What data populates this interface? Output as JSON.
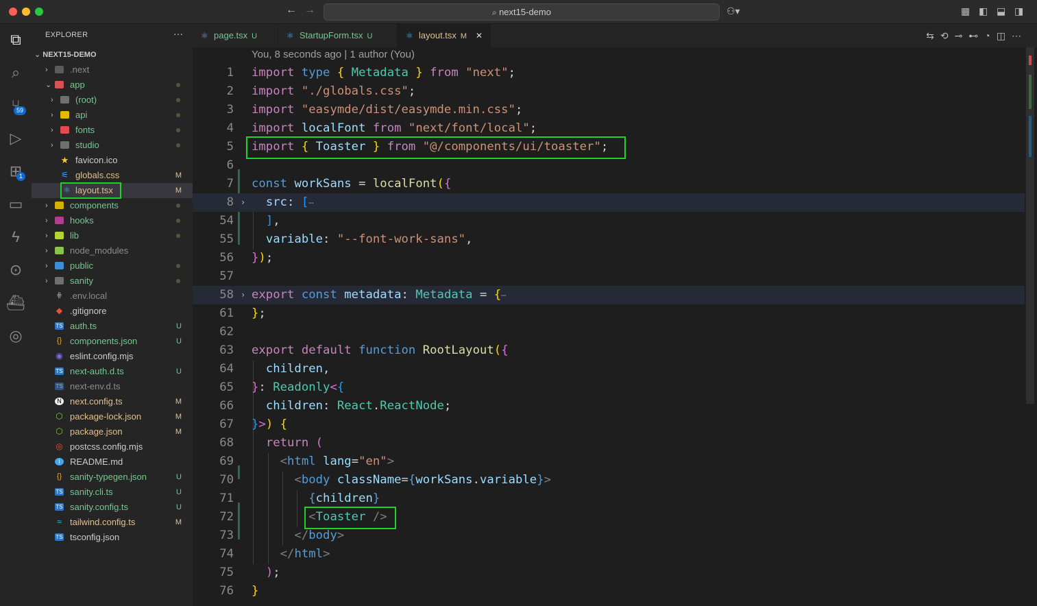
{
  "titlebar": {
    "search_text": "next15-demo"
  },
  "sidebar": {
    "title": "EXPLORER",
    "more": "···",
    "root": "NEXT15-DEMO",
    "rows": [
      {
        "name": ".next",
        "status": ""
      },
      {
        "name": "app",
        "status": ""
      },
      {
        "name": "(root)",
        "status": ""
      },
      {
        "name": "api",
        "status": ""
      },
      {
        "name": "fonts",
        "status": ""
      },
      {
        "name": "studio",
        "status": ""
      },
      {
        "name": "favicon.ico",
        "status": ""
      },
      {
        "name": "globals.css",
        "status": "M"
      },
      {
        "name": "layout.tsx",
        "status": "M"
      },
      {
        "name": "components",
        "status": ""
      },
      {
        "name": "hooks",
        "status": ""
      },
      {
        "name": "lib",
        "status": ""
      },
      {
        "name": "node_modules",
        "status": ""
      },
      {
        "name": "public",
        "status": ""
      },
      {
        "name": "sanity",
        "status": ""
      },
      {
        "name": ".env.local",
        "status": ""
      },
      {
        "name": ".gitignore",
        "status": ""
      },
      {
        "name": "auth.ts",
        "status": "U"
      },
      {
        "name": "components.json",
        "status": "U"
      },
      {
        "name": "eslint.config.mjs",
        "status": ""
      },
      {
        "name": "next-auth.d.ts",
        "status": "U"
      },
      {
        "name": "next-env.d.ts",
        "status": ""
      },
      {
        "name": "next.config.ts",
        "status": "M"
      },
      {
        "name": "package-lock.json",
        "status": "M"
      },
      {
        "name": "package.json",
        "status": "M"
      },
      {
        "name": "postcss.config.mjs",
        "status": ""
      },
      {
        "name": "README.md",
        "status": ""
      },
      {
        "name": "sanity-typegen.json",
        "status": "U"
      },
      {
        "name": "sanity.cli.ts",
        "status": "U"
      },
      {
        "name": "sanity.config.ts",
        "status": "U"
      },
      {
        "name": "tailwind.config.ts",
        "status": "M"
      },
      {
        "name": "tsconfig.json",
        "status": ""
      }
    ]
  },
  "activity": {
    "scm_badge": "59",
    "ext_badge": "1"
  },
  "tabs": [
    {
      "name": "page.tsx",
      "status": "U"
    },
    {
      "name": "StartupForm.tsx",
      "status": "U"
    },
    {
      "name": "layout.tsx",
      "status": "M",
      "close": "✕"
    }
  ],
  "editor": {
    "blame": "You, 8 seconds ago | 1 author (You)",
    "line_numbers": [
      "1",
      "2",
      "3",
      "4",
      "5",
      "6",
      "7",
      "8",
      "54",
      "55",
      "56",
      "57",
      "58",
      "61",
      "62",
      "63",
      "64",
      "65",
      "66",
      "67",
      "68",
      "69",
      "70",
      "71",
      "72",
      "73",
      "74",
      "75",
      "76"
    ]
  },
  "colors": {
    "accent": "#0e6ad1",
    "highlight_box": "#1ed12b",
    "modified": "#e2c08d",
    "untracked": "#73c991"
  }
}
